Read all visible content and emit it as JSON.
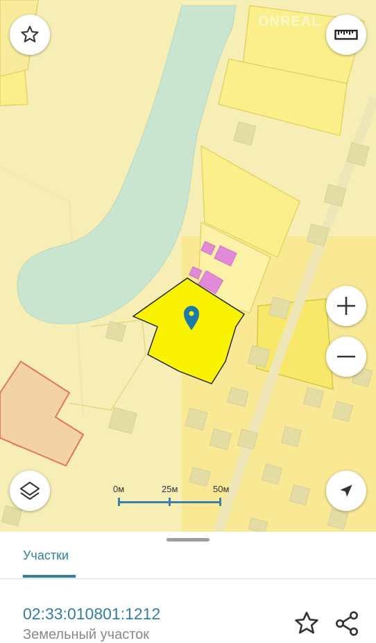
{
  "map": {
    "watermark": "ONREAL",
    "scale": {
      "labels": [
        "0м",
        "25м",
        "50м"
      ]
    },
    "colors": {
      "background": "#f6eeb4",
      "water": "#c9e5cf",
      "parcel": "#fff27a",
      "selected_parcel": "#f9f200",
      "selected_parcel_border": "#1a1a1a",
      "building": "#e3e1a4",
      "building_pink": "#e18ad7",
      "orange_zone": "#f3d3a6",
      "orange_border": "#e0775a",
      "pin": "#1d79a8"
    },
    "icons": {
      "favorites": "star-icon",
      "ruler": "ruler-icon",
      "zoom_in": "plus-icon",
      "zoom_out": "minus-icon",
      "layers": "layers-icon",
      "location": "navigation-arrow-icon",
      "pin": "map-pin-icon"
    }
  },
  "sheet": {
    "tabs": [
      {
        "label": "Участки",
        "active": true
      }
    ],
    "parcel": {
      "cadastral_number": "02:33:010801:1212",
      "type": "Земельный участок"
    },
    "icons": {
      "favorite": "star-outline-icon",
      "share": "share-icon"
    }
  }
}
